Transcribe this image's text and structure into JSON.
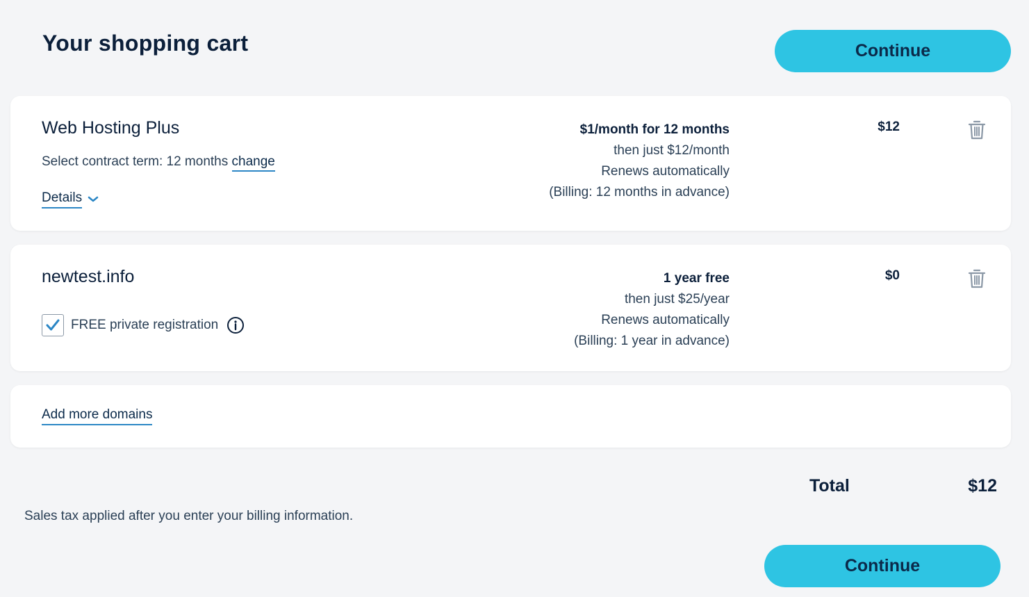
{
  "page": {
    "title": "Your shopping cart"
  },
  "actions": {
    "continue_label": "Continue"
  },
  "cart": {
    "hosting": {
      "name": "Web Hosting Plus",
      "term_prefix": "Select contract term: 12 months",
      "change_label": "change",
      "details_label": "Details",
      "price_lines": [
        "$1/month for 12 months",
        "then just $12/month",
        "Renews automatically",
        "(Billing: 12 months in advance)"
      ],
      "amount": "$12",
      "delete_icon": "trash-icon"
    },
    "domain": {
      "name": "newtest.info",
      "privacy_label": "FREE private registration",
      "privacy_checked": true,
      "info_icon": "info-icon",
      "price_lines": [
        "1 year free",
        "then just $25/year",
        "Renews automatically",
        "(Billing: 1 year in advance)"
      ],
      "amount": "$0",
      "delete_icon": "trash-icon"
    },
    "add_more_label": "Add more domains"
  },
  "summary": {
    "total_label": "Total",
    "total_value": "$12",
    "tax_note": "Sales tax applied after you enter your billing information."
  },
  "colors": {
    "accent": "#2ec4e3",
    "link_underline": "#2b86c5",
    "text_dark": "#0b1f3a",
    "background": "#f4f5f7"
  }
}
